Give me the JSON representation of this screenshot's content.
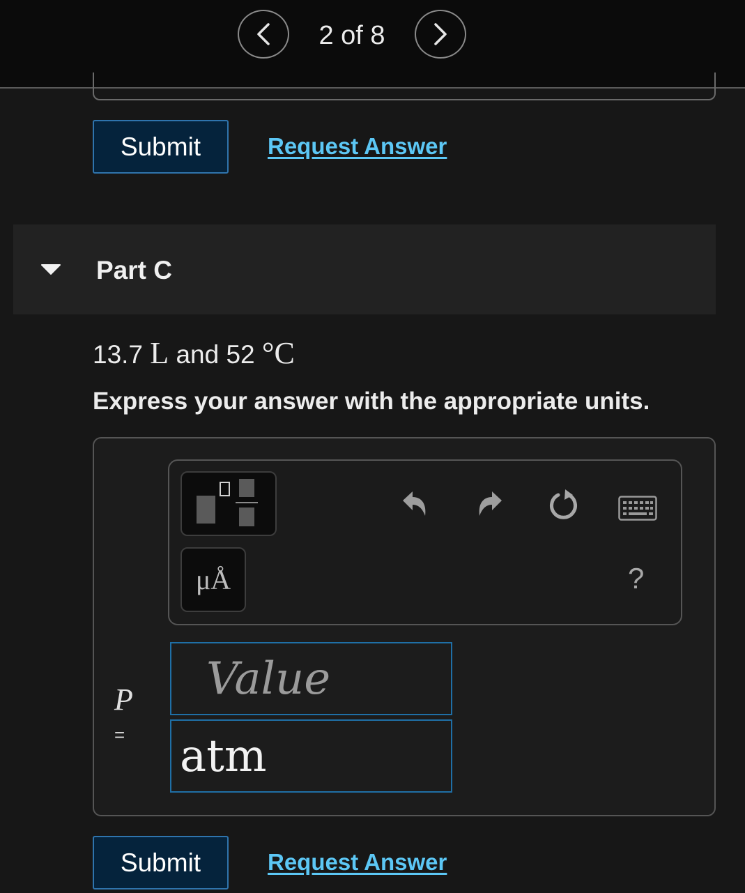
{
  "pager": {
    "text": "2 of 8",
    "prev_icon": "chevron-left-icon",
    "next_icon": "chevron-right-icon"
  },
  "previous_part": {
    "submit_label": "Submit",
    "request_answer_label": "Request Answer"
  },
  "part": {
    "title": "Part C",
    "problem_volume": "13.7",
    "problem_volume_unit": "L",
    "problem_and": "and",
    "problem_temp": "52",
    "problem_temp_unit": "°C",
    "instruction": "Express your answer with the appropriate units."
  },
  "toolbar": {
    "templates_icon": "templates-icon",
    "units_label": "μÅ",
    "undo_icon": "undo-icon",
    "redo_icon": "redo-icon",
    "reset_icon": "reset-icon",
    "keyboard_icon": "keyboard-icon",
    "help_label": "?"
  },
  "answer": {
    "variable": "P",
    "equals": "=",
    "value_placeholder": "Value",
    "units_value": "atm"
  },
  "actions": {
    "submit_label": "Submit",
    "request_answer_label": "Request Answer"
  },
  "colors": {
    "submit_bg": "#05233c",
    "link": "#5cc7f5",
    "field_border": "#1f6fa6"
  }
}
